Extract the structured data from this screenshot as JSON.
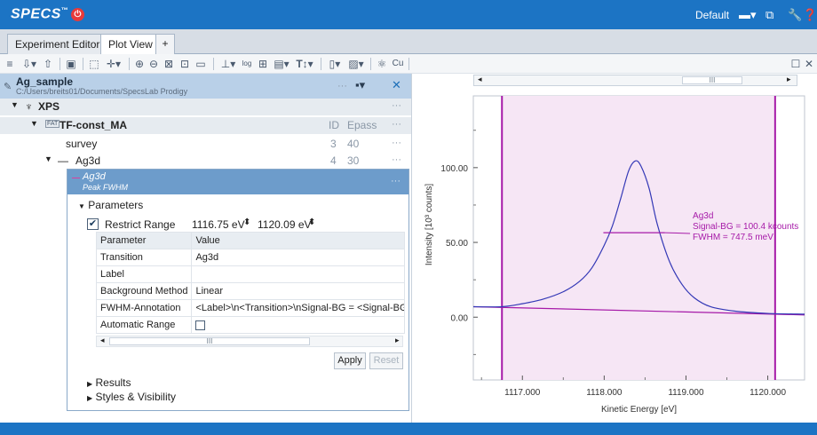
{
  "app": {
    "logo": "SPECS",
    "logo_mark": "™",
    "layout_name": "Default"
  },
  "tabs": [
    {
      "label": "Experiment Editor"
    },
    {
      "label": "Plot View"
    },
    {
      "label": "+"
    }
  ],
  "toolbar_icons": [
    "menu-icon",
    "import-icon",
    "export-icon",
    "save-icon",
    "select-icon",
    "cursor-icon",
    "zoom-in-icon",
    "zoom-out-icon",
    "fit-icon",
    "fit-x-icon",
    "screenshot-icon",
    "peak-icon",
    "log-scale-icon",
    "grid-icon",
    "layout-icon",
    "text-icon",
    "page-icon",
    "image-icon",
    "atom-icon",
    "cu-icon"
  ],
  "tree": {
    "document": {
      "name": "Ag_sample",
      "path": "C:/Users/breits01/Documents/SpecsLab Prodigy"
    },
    "group": {
      "name": "XPS"
    },
    "dataset": {
      "name": "TF-const_MA",
      "tag": "FAT",
      "col_id": "ID",
      "col_epass": "Epass"
    },
    "items": [
      {
        "name": "survey",
        "id": "3",
        "epass": "40"
      },
      {
        "name": "Ag3d",
        "id": "4",
        "epass": "30"
      }
    ]
  },
  "peak": {
    "name": "Ag3d",
    "kind": "Peak FWHM",
    "parameters_label": "Parameters",
    "restrict_range_label": "Restrict Range",
    "range_from": "1116.75 eV",
    "range_to": "1120.09 eV",
    "table_header": {
      "param": "Parameter",
      "value": "Value"
    },
    "rows": [
      {
        "param": "Transition",
        "value": "Ag3d"
      },
      {
        "param": "Label",
        "value": ""
      },
      {
        "param": "Background Method",
        "value": "Linear"
      },
      {
        "param": "FWHM-Annotation",
        "value": "<Label>\\n<Transition>\\nSignal-BG = <Signal-BG"
      },
      {
        "param": "Automatic Range",
        "value": ""
      }
    ],
    "scroll_thumb": "III",
    "apply_label": "Apply",
    "reset_label": "Reset",
    "results_label": "Results",
    "styles_label": "Styles & Visibility"
  },
  "plot": {
    "scroll_thumb": "III",
    "annotation": [
      "Ag3d",
      "Signal-BG = 100.4 kcounts",
      "FWHM = 747.5 meV"
    ]
  },
  "chart_data": {
    "type": "line",
    "xlabel": "Kinetic Energy [eV]",
    "ylabel": "Intensity [10³ counts]",
    "x_ticks": [
      "1117.000",
      "1118.000",
      "1119.000",
      "1120.000"
    ],
    "y_ticks": [
      "0.00",
      "50.00",
      "100.00"
    ],
    "xlim": [
      1116.4,
      1120.45
    ],
    "ylim": [
      -42,
      148
    ],
    "range_markers": [
      1116.75,
      1120.09
    ],
    "series": [
      {
        "x": [
          1116.4,
          1116.75,
          1117.0,
          1117.25,
          1117.5,
          1117.7,
          1117.85,
          1118.0,
          1118.1,
          1118.2,
          1118.3,
          1118.38,
          1118.45,
          1118.55,
          1118.65,
          1118.8,
          1118.95,
          1119.1,
          1119.3,
          1119.6,
          1120.0,
          1120.45
        ],
        "y": [
          7,
          7,
          9,
          12,
          17,
          24,
          33,
          48,
          61,
          79,
          98,
          104.5,
          101,
          86,
          62,
          37,
          22,
          13,
          7,
          4,
          2.5,
          2
        ]
      }
    ],
    "background_line": {
      "x": [
        1116.4,
        1120.45
      ],
      "y": [
        7,
        1.5
      ]
    },
    "fwhm_line": {
      "x": [
        1117.99,
        1118.74
      ],
      "y": [
        56.5,
        56.5
      ]
    }
  },
  "colors": {
    "brand_blue": "#1c74c4",
    "range_fill": "#f6e6f5",
    "range_border": "#a61aa8",
    "curve": "#3338b6",
    "background": "#a61aa8",
    "annotation": "#a61aa8"
  }
}
